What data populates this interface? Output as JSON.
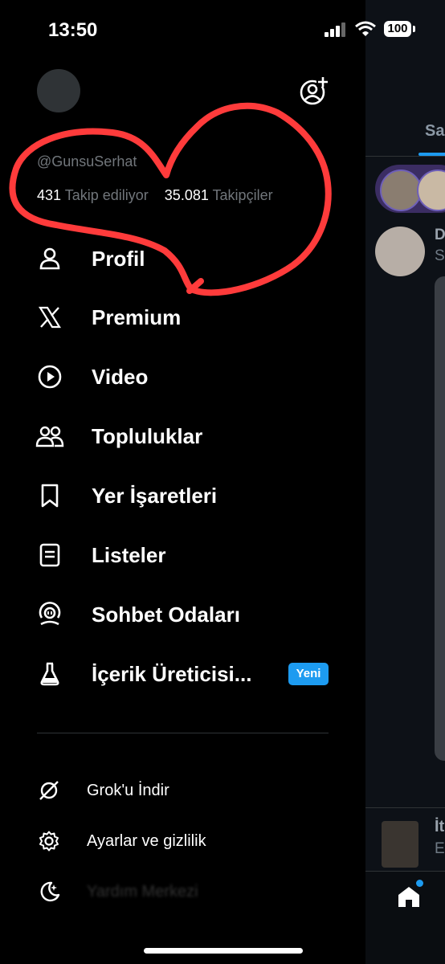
{
  "status_bar": {
    "time": "13:50",
    "battery": "100"
  },
  "profile": {
    "handle": "@GunsuSerhat",
    "following_count": "431",
    "following_label": "Takip ediliyor",
    "followers_count": "35.081",
    "followers_label": "Takipçiler"
  },
  "menu": [
    {
      "label": "Profil",
      "icon": "person-icon"
    },
    {
      "label": "Premium",
      "icon": "x-logo-icon"
    },
    {
      "label": "Video",
      "icon": "play-icon"
    },
    {
      "label": "Topluluklar",
      "icon": "people-icon"
    },
    {
      "label": "Yer İşaretleri",
      "icon": "bookmark-icon"
    },
    {
      "label": "Listeler",
      "icon": "list-icon"
    },
    {
      "label": "Sohbet Odaları",
      "icon": "spaces-icon"
    },
    {
      "label": "İçerik Üreticisi...",
      "icon": "flask-icon",
      "badge": "Yeni"
    }
  ],
  "sub_menu": [
    {
      "label": "Grok'u İndir",
      "icon": "grok-icon"
    },
    {
      "label": "Ayarlar ve gizlilik",
      "icon": "gear-icon"
    },
    {
      "label": "Yardım Merkezi",
      "icon": "moon-icon"
    }
  ],
  "background_feed": {
    "tab_fragment": "Sa",
    "post1_name_fragment": "D",
    "post1_text_fragment": "S",
    "post2_name_fragment": "İt",
    "post2_text_fragment": "E"
  },
  "colors": {
    "accent": "#1d9bf0",
    "annotation": "#ff3b3b",
    "background": "#000000"
  }
}
